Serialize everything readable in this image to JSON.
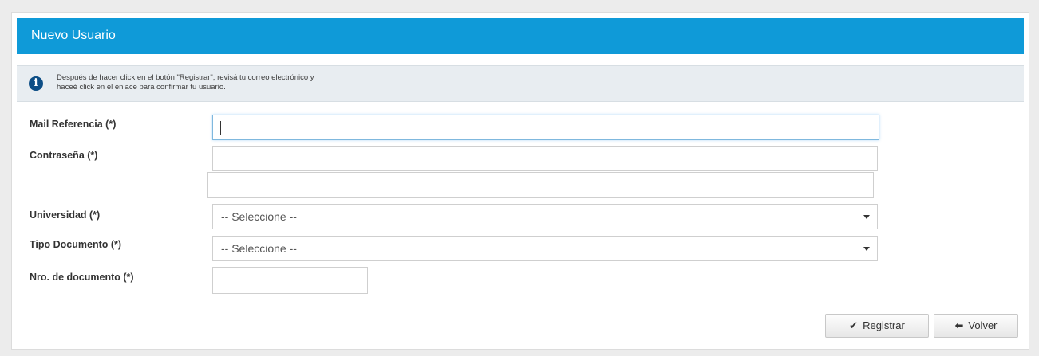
{
  "panel": {
    "title": "Nuevo Usuario",
    "info": {
      "icon": "info-icon",
      "line1": "Después de hacer click en el botón \"Registrar\", revisá tu correo electrónico y",
      "line2": "haceé click en el enlace para confirmar tu usuario."
    }
  },
  "form": {
    "email_label": "Mail Referencia (*)",
    "email_value": "",
    "password_label": "Contraseña (*)",
    "password_value": "",
    "password_confirm_value": "",
    "university_label": "Universidad (*)",
    "university_selected": "-- Seleccione --",
    "doc_type_label": "Tipo Documento (*)",
    "doc_type_selected": "-- Seleccione --",
    "doc_number_label": "Nro. de documento (*)",
    "doc_number_value": ""
  },
  "buttons": {
    "register_label": "Registrar",
    "register_icon": "check-icon",
    "back_label": "Volver",
    "back_icon": "arrow-left-icon"
  },
  "colors": {
    "header_bg": "#0f9ad8",
    "info_bg": "#e8edf1",
    "info_icon": "#0d4e86"
  }
}
